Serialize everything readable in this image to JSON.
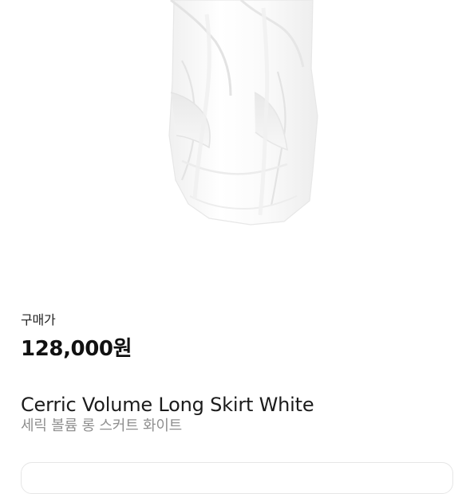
{
  "product": {
    "price_label": "구매가",
    "price": "128,000원",
    "title_en": "Cerric Volume Long Skirt White",
    "title_ko": "세릭 볼륨 롱 스커트 화이트"
  },
  "colors": {
    "background": "#ffffff",
    "text_primary": "#111111",
    "text_secondary": "#8f8f8f",
    "card_border": "#e6e6e6"
  }
}
